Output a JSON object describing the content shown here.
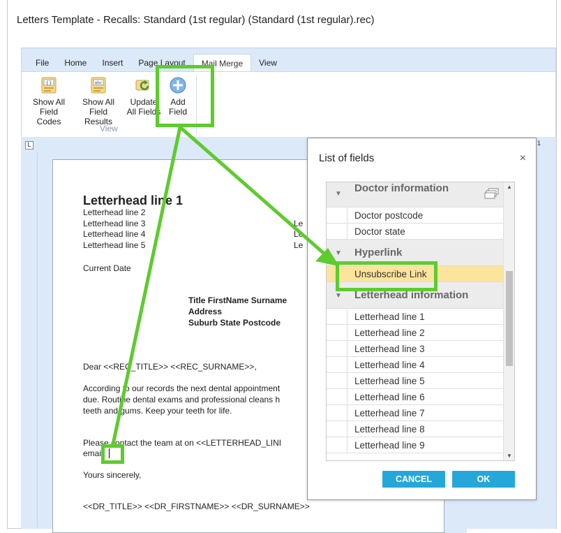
{
  "window": {
    "title": "Letters Template - Recalls: Standard (1st regular) (Standard (1st regular).rec)"
  },
  "ribbon": {
    "tabs": [
      "File",
      "Home",
      "Insert",
      "Page Layout",
      "Mail Merge",
      "View"
    ],
    "active_tab": "Mail Merge",
    "buttons": {
      "show_all_codes": [
        "Show All",
        "Field Codes"
      ],
      "show_all_results": [
        "Show All",
        "Field Results"
      ],
      "update_all": [
        "Update",
        "All Fields"
      ],
      "add_field": [
        "Add",
        "Field"
      ]
    },
    "group_label": "View"
  },
  "ruler": {
    "corner": "L",
    "right_marker": "1"
  },
  "document": {
    "letterhead_title": "Letterhead line 1",
    "letterhead_lines": [
      "Letterhead line 2",
      "Letterhead line 3",
      "Letterhead line 4",
      "Letterhead line 5"
    ],
    "right_fragments": [
      "Le",
      "Le",
      "Le"
    ],
    "current_date": "Current Date",
    "address": [
      "Title FirstName Surname",
      "Address",
      "Suburb State Postcode"
    ],
    "greeting": "Dear <<REC_TITLE>> <<REC_SURNAME>>,",
    "body_lines": [
      "According to our records the next dental appointment",
      "due. Routine dental exams and professional cleans h",
      "teeth and gums. Keep your teeth for life."
    ],
    "contact_line": "Please contact the team at on <<LETTERHEAD_LINI",
    "email_line": "email.",
    "closing": "Yours sincerely,",
    "signature": "<<DR_TITLE>> <<DR_FIRSTNAME>> <<DR_SURNAME>>"
  },
  "dialog": {
    "title": "List of fields",
    "close": "×",
    "groups": [
      {
        "name": "Doctor information",
        "items": [
          "Doctor postcode",
          "Doctor state"
        ]
      },
      {
        "name": "Hyperlink",
        "items": [
          "Unsubscribe Link"
        ]
      },
      {
        "name": "Letterhead information",
        "items": [
          "Letterhead line 1",
          "Letterhead line 2",
          "Letterhead line 3",
          "Letterhead line 4",
          "Letterhead line 5",
          "Letterhead line 6",
          "Letterhead line 7",
          "Letterhead line 8",
          "Letterhead line 9"
        ]
      }
    ],
    "selected_item": "Unsubscribe Link",
    "cancel_label": "CANCEL",
    "ok_label": "OK"
  },
  "colors": {
    "highlight": "#5ecb2e",
    "button": "#25a8d9",
    "selected_row": "#fce49c",
    "ribbon_bg": "#dce9f8"
  }
}
